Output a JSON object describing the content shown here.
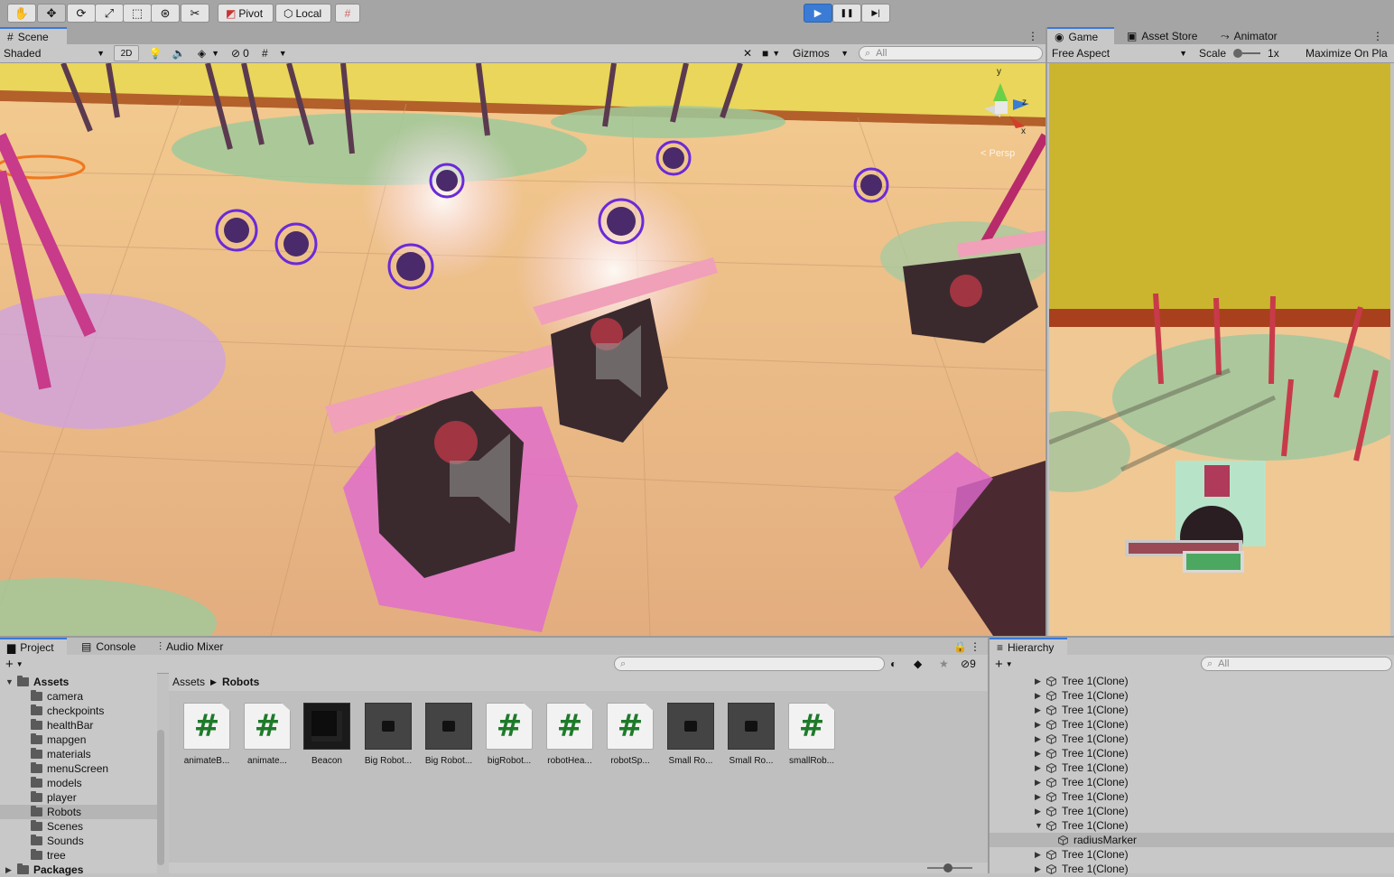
{
  "toolbar": {
    "tools": [
      "hand-tool",
      "move-tool",
      "rotate-tool",
      "scale-tool",
      "rect-tool",
      "transform-tool",
      "custom-tool"
    ],
    "pivot_label": "Pivot",
    "local_label": "Local",
    "play": "▶",
    "pause": "❚❚",
    "step": "▶|"
  },
  "scene_panel": {
    "tab_label": "Scene",
    "shading_mode": "Shaded",
    "toggle_2d": "2D",
    "hidden_count": "0",
    "gizmos_label": "Gizmos",
    "search_placeholder": "All",
    "persp_label": "< Persp"
  },
  "game_panel": {
    "tabs": [
      "Game",
      "Asset Store",
      "Animator"
    ],
    "aspect": "Free Aspect",
    "scale_label": "Scale",
    "scale_value": "1x",
    "maximize_label": "Maximize On Pla"
  },
  "project_panel": {
    "tabs": [
      "Project",
      "Console",
      "Audio Mixer"
    ],
    "breadcrumb": [
      "Assets",
      "Robots"
    ],
    "hidden_count": "9",
    "tree": [
      {
        "label": "Assets",
        "level": 0,
        "expanded": true
      },
      {
        "label": "camera",
        "level": 1
      },
      {
        "label": "checkpoints",
        "level": 1
      },
      {
        "label": "healthBar",
        "level": 1
      },
      {
        "label": "mapgen",
        "level": 1
      },
      {
        "label": "materials",
        "level": 1
      },
      {
        "label": "menuScreen",
        "level": 1
      },
      {
        "label": "models",
        "level": 1
      },
      {
        "label": "player",
        "level": 1
      },
      {
        "label": "Robots",
        "level": 1,
        "selected": true
      },
      {
        "label": "Scenes",
        "level": 1
      },
      {
        "label": "Sounds",
        "level": 1
      },
      {
        "label": "tree",
        "level": 1
      },
      {
        "label": "Packages",
        "level": 0
      }
    ],
    "assets": [
      {
        "label": "animateB...",
        "kind": "script"
      },
      {
        "label": "animate...",
        "kind": "script"
      },
      {
        "label": "Beacon",
        "kind": "cube"
      },
      {
        "label": "Big Robot...",
        "kind": "model"
      },
      {
        "label": "Big Robot...",
        "kind": "model"
      },
      {
        "label": "bigRobot...",
        "kind": "script"
      },
      {
        "label": "robotHea...",
        "kind": "script"
      },
      {
        "label": "robotSp...",
        "kind": "script"
      },
      {
        "label": "Small Ro...",
        "kind": "model"
      },
      {
        "label": "Small Ro...",
        "kind": "model"
      },
      {
        "label": "smallRob...",
        "kind": "script"
      }
    ]
  },
  "hierarchy_panel": {
    "tab_label": "Hierarchy",
    "search_placeholder": "All",
    "rows": [
      {
        "label": "Tree 1(Clone)",
        "expanded": false
      },
      {
        "label": "Tree 1(Clone)",
        "expanded": false
      },
      {
        "label": "Tree 1(Clone)",
        "expanded": false
      },
      {
        "label": "Tree 1(Clone)",
        "expanded": false
      },
      {
        "label": "Tree 1(Clone)",
        "expanded": false
      },
      {
        "label": "Tree 1(Clone)",
        "expanded": false
      },
      {
        "label": "Tree 1(Clone)",
        "expanded": false
      },
      {
        "label": "Tree 1(Clone)",
        "expanded": false
      },
      {
        "label": "Tree 1(Clone)",
        "expanded": false
      },
      {
        "label": "Tree 1(Clone)",
        "expanded": false
      },
      {
        "label": "Tree 1(Clone)",
        "expanded": true
      },
      {
        "label": "radiusMarker",
        "child": true,
        "selected": true
      },
      {
        "label": "Tree 1(Clone)",
        "expanded": false
      },
      {
        "label": "Tree 1(Clone)",
        "expanded": false
      }
    ]
  },
  "colors": {
    "accent": "#3a7bd5",
    "script_hash": "#1e7a2a",
    "selection": "#b5b5b5"
  }
}
